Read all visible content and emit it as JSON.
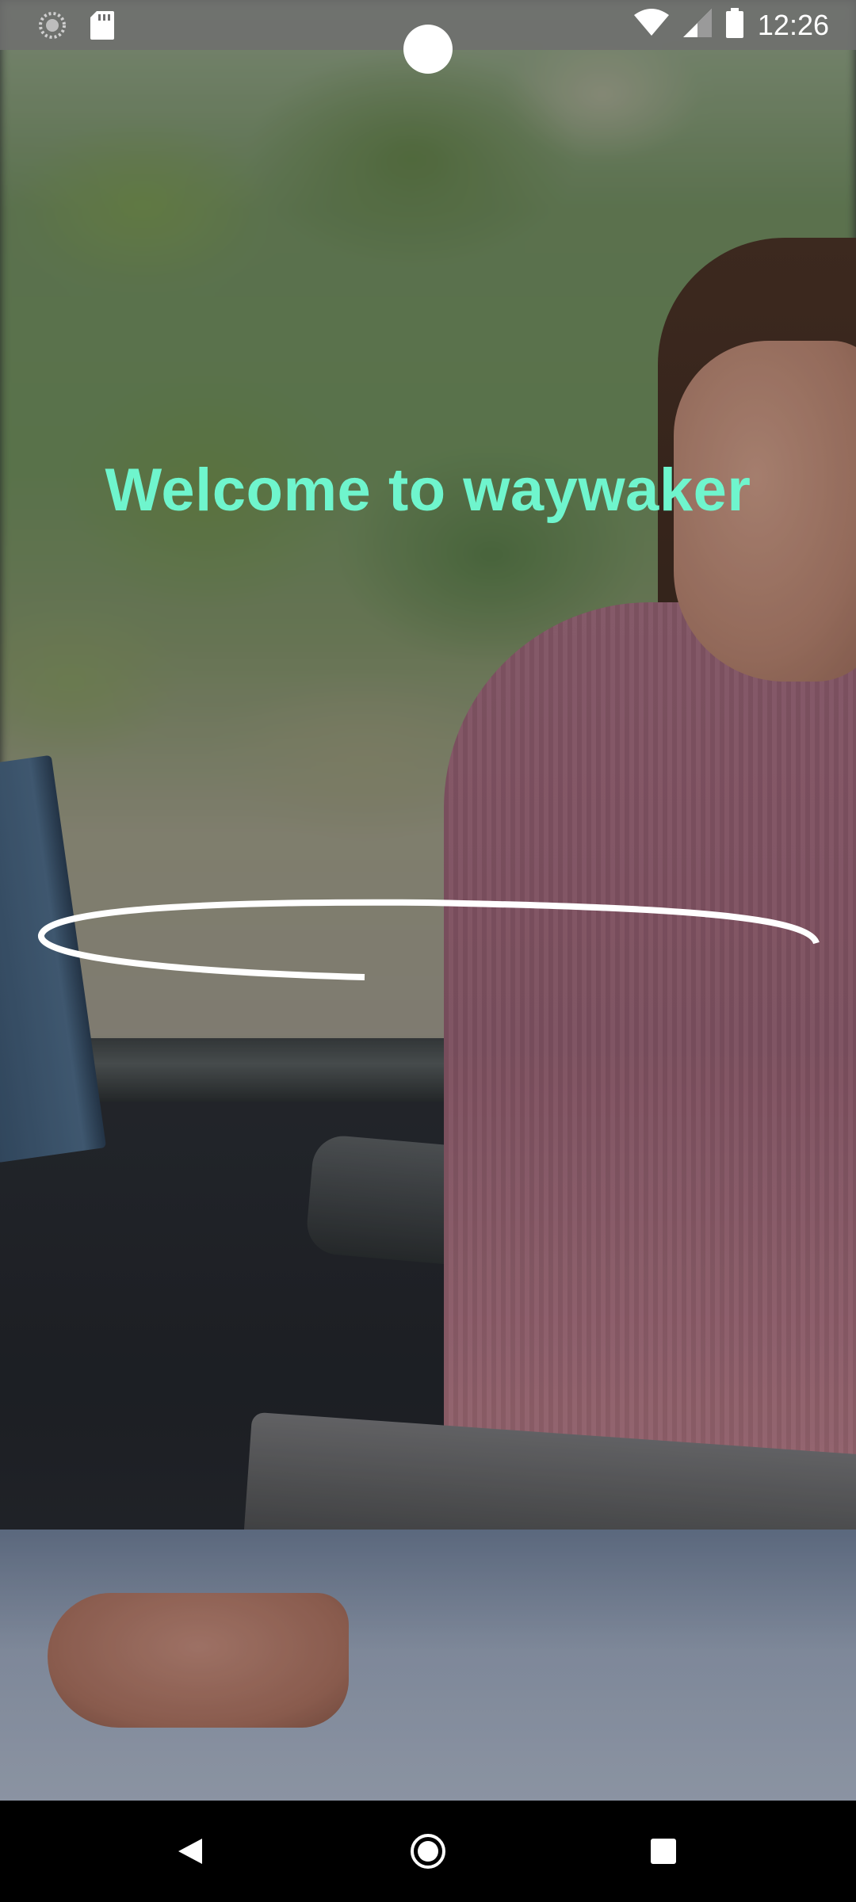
{
  "status_bar": {
    "time": "12:26",
    "left_icons": [
      "loading-spinner-icon",
      "sd-card-icon"
    ],
    "right_icons": [
      "wifi-icon",
      "cell-signal-icon",
      "battery-icon"
    ]
  },
  "welcome": {
    "title": "Welcome to waywaker",
    "title_color": "#6ff5cd"
  },
  "loader": {
    "icon": "progress-swoosh-icon",
    "color": "#ffffff"
  },
  "navigation_bar": {
    "buttons": [
      "back-icon",
      "home-icon",
      "recents-icon"
    ]
  }
}
